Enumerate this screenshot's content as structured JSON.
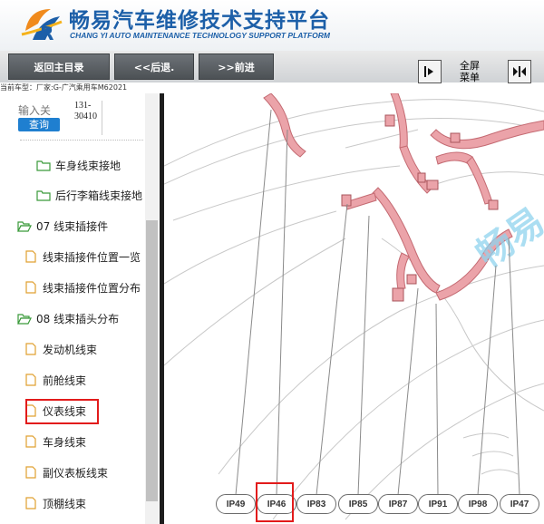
{
  "header": {
    "title": "畅易汽车维修技术支持平台",
    "subtitle": "CHANG YI AUTO MAINTENANCE TECHNOLOGY SUPPORT PLATFORM"
  },
  "toolbar": {
    "home_label": "返回主目录",
    "back_label": "<<后退.",
    "forward_label": ">>前进",
    "fullscreen_label_1": "全屏",
    "fullscreen_label_2": "菜单"
  },
  "status": {
    "text": "当前车型：厂家:G-广汽乘用车M62021"
  },
  "search": {
    "placeholder": "输入关",
    "button_label": "查询",
    "result_line1": "131-",
    "result_line2": "30410"
  },
  "tree": {
    "items": [
      {
        "label": "车身线束接地",
        "icon": "folder-icon"
      },
      {
        "label": "后行李箱线束接地",
        "icon": "folder-icon"
      },
      {
        "label": "07 线束插接件",
        "icon": "folder-open-icon"
      },
      {
        "label": "线束插接件位置一览",
        "icon": "document-icon"
      },
      {
        "label": "线束插接件位置分布",
        "icon": "document-icon"
      },
      {
        "label": "08 线束插头分布",
        "icon": "folder-open-icon"
      },
      {
        "label": "发动机线束",
        "icon": "document-icon"
      },
      {
        "label": "前舱线束",
        "icon": "document-icon"
      },
      {
        "label": "仪表线束",
        "icon": "document-icon",
        "highlighted": true
      },
      {
        "label": "车身线束",
        "icon": "document-icon"
      },
      {
        "label": "副仪表板线束",
        "icon": "document-icon"
      },
      {
        "label": "顶棚线束",
        "icon": "document-icon"
      }
    ]
  },
  "diagram": {
    "watermark": "畅易",
    "connectors": [
      "IP49",
      "IP46",
      "IP83",
      "IP85",
      "IP87",
      "IP91",
      "IP98",
      "IP47"
    ],
    "highlighted_connector": "IP46"
  },
  "colors": {
    "brand_blue": "#1c5fa8",
    "harness_pink": "#e89aa0",
    "highlight_red": "#e21b1b"
  }
}
